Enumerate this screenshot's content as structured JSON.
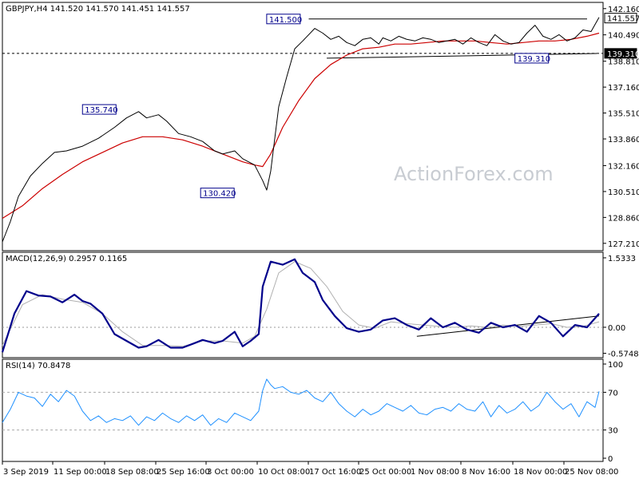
{
  "watermark": "ActionForex.com",
  "chart_data": [
    {
      "type": "line",
      "title": "GBPJPY,H4 141.520 141.570 141.451 141.557",
      "price_ylim": [
        127.2,
        142.2
      ],
      "y_ticks": [
        "142.160",
        "140.490",
        "138.810",
        "137.160",
        "135.510",
        "133.860",
        "132.160",
        "130.510",
        "128.860",
        "127.210"
      ],
      "x_labels": [
        "3 Sep 2019",
        "11 Sep 00:00",
        "18 Sep 08:00",
        "25 Sep 16:00",
        "3 Oct 00:00",
        "10 Oct 08:00",
        "17 Oct 16:00",
        "25 Oct 00:00",
        "1 Nov 08:00",
        "8 Nov 16:00",
        "18 Nov 00:00",
        "25 Nov 08:00"
      ],
      "current_price": "141.557",
      "support_price": "139.310",
      "annotations": [
        "141.500",
        "135.740",
        "130.420",
        "139.310"
      ],
      "series": [
        {
          "name": "price",
          "color": "#000000",
          "x": [
            0,
            4,
            8,
            14,
            20,
            26,
            32,
            40,
            48,
            56,
            62,
            68,
            72,
            78,
            82,
            88,
            94,
            100,
            106,
            110,
            116,
            120,
            126,
            130,
            132,
            134,
            138,
            142,
            146,
            150,
            156,
            160,
            164,
            168,
            172,
            176,
            180,
            184,
            188,
            190,
            194,
            198,
            202,
            206,
            210,
            214,
            218,
            222,
            226,
            230,
            234,
            238,
            242,
            246,
            250,
            254,
            258,
            262,
            266,
            270,
            274,
            278,
            282,
            286,
            290,
            294,
            298
          ],
          "values": [
            127.3,
            128.6,
            130.2,
            131.5,
            132.3,
            133.0,
            133.1,
            133.4,
            133.9,
            134.6,
            135.2,
            135.6,
            135.2,
            135.4,
            135.0,
            134.2,
            134.0,
            133.7,
            133.1,
            132.9,
            133.1,
            132.6,
            132.2,
            131.2,
            130.6,
            131.8,
            135.9,
            137.8,
            139.6,
            140.1,
            140.9,
            140.6,
            140.2,
            140.4,
            140.0,
            139.8,
            140.2,
            140.3,
            139.9,
            140.3,
            140.1,
            140.4,
            140.2,
            140.1,
            140.3,
            140.2,
            140.0,
            140.1,
            140.2,
            139.9,
            140.3,
            140.0,
            139.8,
            140.5,
            140.1,
            139.9,
            140.0,
            140.6,
            141.1,
            140.4,
            140.2,
            140.5,
            140.1,
            140.3,
            140.8,
            140.7,
            141.6
          ]
        },
        {
          "name": "sma",
          "color": "#cc0000",
          "x": [
            0,
            10,
            20,
            30,
            40,
            50,
            60,
            70,
            80,
            90,
            100,
            110,
            120,
            126,
            130,
            134,
            140,
            148,
            156,
            164,
            172,
            180,
            188,
            196,
            204,
            212,
            220,
            228,
            236,
            244,
            252,
            260,
            268,
            276,
            284,
            292,
            298
          ],
          "values": [
            128.8,
            129.6,
            130.7,
            131.6,
            132.4,
            133.0,
            133.6,
            134.0,
            134.0,
            133.8,
            133.4,
            132.9,
            132.4,
            132.2,
            132.1,
            132.9,
            134.6,
            136.3,
            137.7,
            138.6,
            139.2,
            139.6,
            139.7,
            139.9,
            139.9,
            140.0,
            140.1,
            140.1,
            140.1,
            140.0,
            139.9,
            140.0,
            140.1,
            140.1,
            140.2,
            140.4,
            140.6
          ]
        }
      ]
    },
    {
      "type": "line",
      "title": "MACD(12,26,9) 0.2957 0.1165",
      "ylim": [
        -0.6,
        1.55
      ],
      "y_ticks": [
        "1.5333",
        "0.00",
        "-0.5748"
      ],
      "series": [
        {
          "name": "MACD",
          "color": "#00008b",
          "x": [
            0,
            6,
            12,
            18,
            24,
            30,
            36,
            40,
            44,
            50,
            56,
            62,
            68,
            72,
            78,
            84,
            90,
            96,
            100,
            106,
            110,
            116,
            120,
            124,
            128,
            130,
            134,
            140,
            146,
            150,
            156,
            160,
            166,
            172,
            178,
            184,
            190,
            196,
            202,
            208,
            214,
            220,
            226,
            232,
            238,
            244,
            250,
            256,
            262,
            268,
            274,
            280,
            286,
            292,
            298
          ],
          "values": [
            -0.55,
            0.3,
            0.8,
            0.7,
            0.68,
            0.55,
            0.72,
            0.58,
            0.52,
            0.3,
            -0.15,
            -0.3,
            -0.45,
            -0.42,
            -0.28,
            -0.45,
            -0.45,
            -0.35,
            -0.28,
            -0.35,
            -0.3,
            -0.1,
            -0.42,
            -0.3,
            -0.15,
            0.9,
            1.45,
            1.38,
            1.5,
            1.2,
            1.0,
            0.6,
            0.25,
            -0.02,
            -0.1,
            -0.05,
            0.15,
            0.2,
            0.05,
            -0.05,
            0.2,
            0.0,
            0.1,
            -0.05,
            -0.12,
            0.1,
            0.0,
            0.05,
            -0.1,
            0.25,
            0.1,
            -0.2,
            0.05,
            0.0,
            0.3
          ]
        },
        {
          "name": "Signal",
          "color": "#b0b0b0",
          "x": [
            0,
            10,
            20,
            30,
            40,
            50,
            60,
            70,
            80,
            90,
            100,
            110,
            120,
            126,
            132,
            138,
            146,
            154,
            162,
            170,
            178,
            186,
            194,
            202,
            210,
            218,
            226,
            234,
            242,
            250,
            258,
            266,
            274,
            282,
            290,
            298
          ],
          "values": [
            -0.4,
            0.5,
            0.72,
            0.62,
            0.55,
            0.3,
            -0.1,
            -0.4,
            -0.4,
            -0.42,
            -0.3,
            -0.3,
            -0.35,
            -0.2,
            0.4,
            1.2,
            1.45,
            1.3,
            0.9,
            0.35,
            0.05,
            -0.02,
            0.12,
            0.08,
            0.05,
            0.02,
            0.0,
            0.03,
            0.0,
            0.05,
            0.02,
            0.05,
            0.08,
            0.0,
            0.02,
            0.12
          ]
        }
      ]
    },
    {
      "type": "line",
      "title": "RSI(14) 70.8478",
      "ylim": [
        0,
        100
      ],
      "y_ticks": [
        "100",
        "70",
        "30",
        "0"
      ],
      "levels": [
        70,
        30
      ],
      "series": [
        {
          "name": "RSI",
          "color": "#1e90ff",
          "x": [
            0,
            4,
            8,
            12,
            16,
            20,
            24,
            28,
            32,
            36,
            40,
            44,
            48,
            52,
            56,
            60,
            64,
            68,
            72,
            76,
            80,
            84,
            88,
            92,
            96,
            100,
            104,
            108,
            112,
            116,
            120,
            124,
            128,
            130,
            132,
            134,
            136,
            140,
            144,
            148,
            152,
            156,
            160,
            164,
            168,
            172,
            176,
            180,
            184,
            188,
            192,
            196,
            200,
            204,
            208,
            212,
            216,
            220,
            224,
            228,
            232,
            236,
            240,
            244,
            248,
            252,
            256,
            260,
            264,
            268,
            272,
            276,
            280,
            284,
            288,
            292,
            296,
            298
          ],
          "values": [
            38,
            52,
            70,
            66,
            64,
            55,
            68,
            60,
            72,
            66,
            50,
            40,
            45,
            38,
            42,
            40,
            45,
            35,
            44,
            40,
            48,
            42,
            38,
            45,
            40,
            46,
            35,
            42,
            38,
            48,
            44,
            40,
            50,
            72,
            84,
            78,
            74,
            76,
            70,
            68,
            72,
            64,
            60,
            70,
            58,
            50,
            44,
            52,
            46,
            50,
            58,
            54,
            50,
            56,
            48,
            46,
            52,
            54,
            50,
            58,
            52,
            50,
            60,
            44,
            56,
            48,
            52,
            60,
            50,
            56,
            70,
            60,
            52,
            58,
            44,
            60,
            54,
            71
          ]
        }
      ]
    }
  ]
}
